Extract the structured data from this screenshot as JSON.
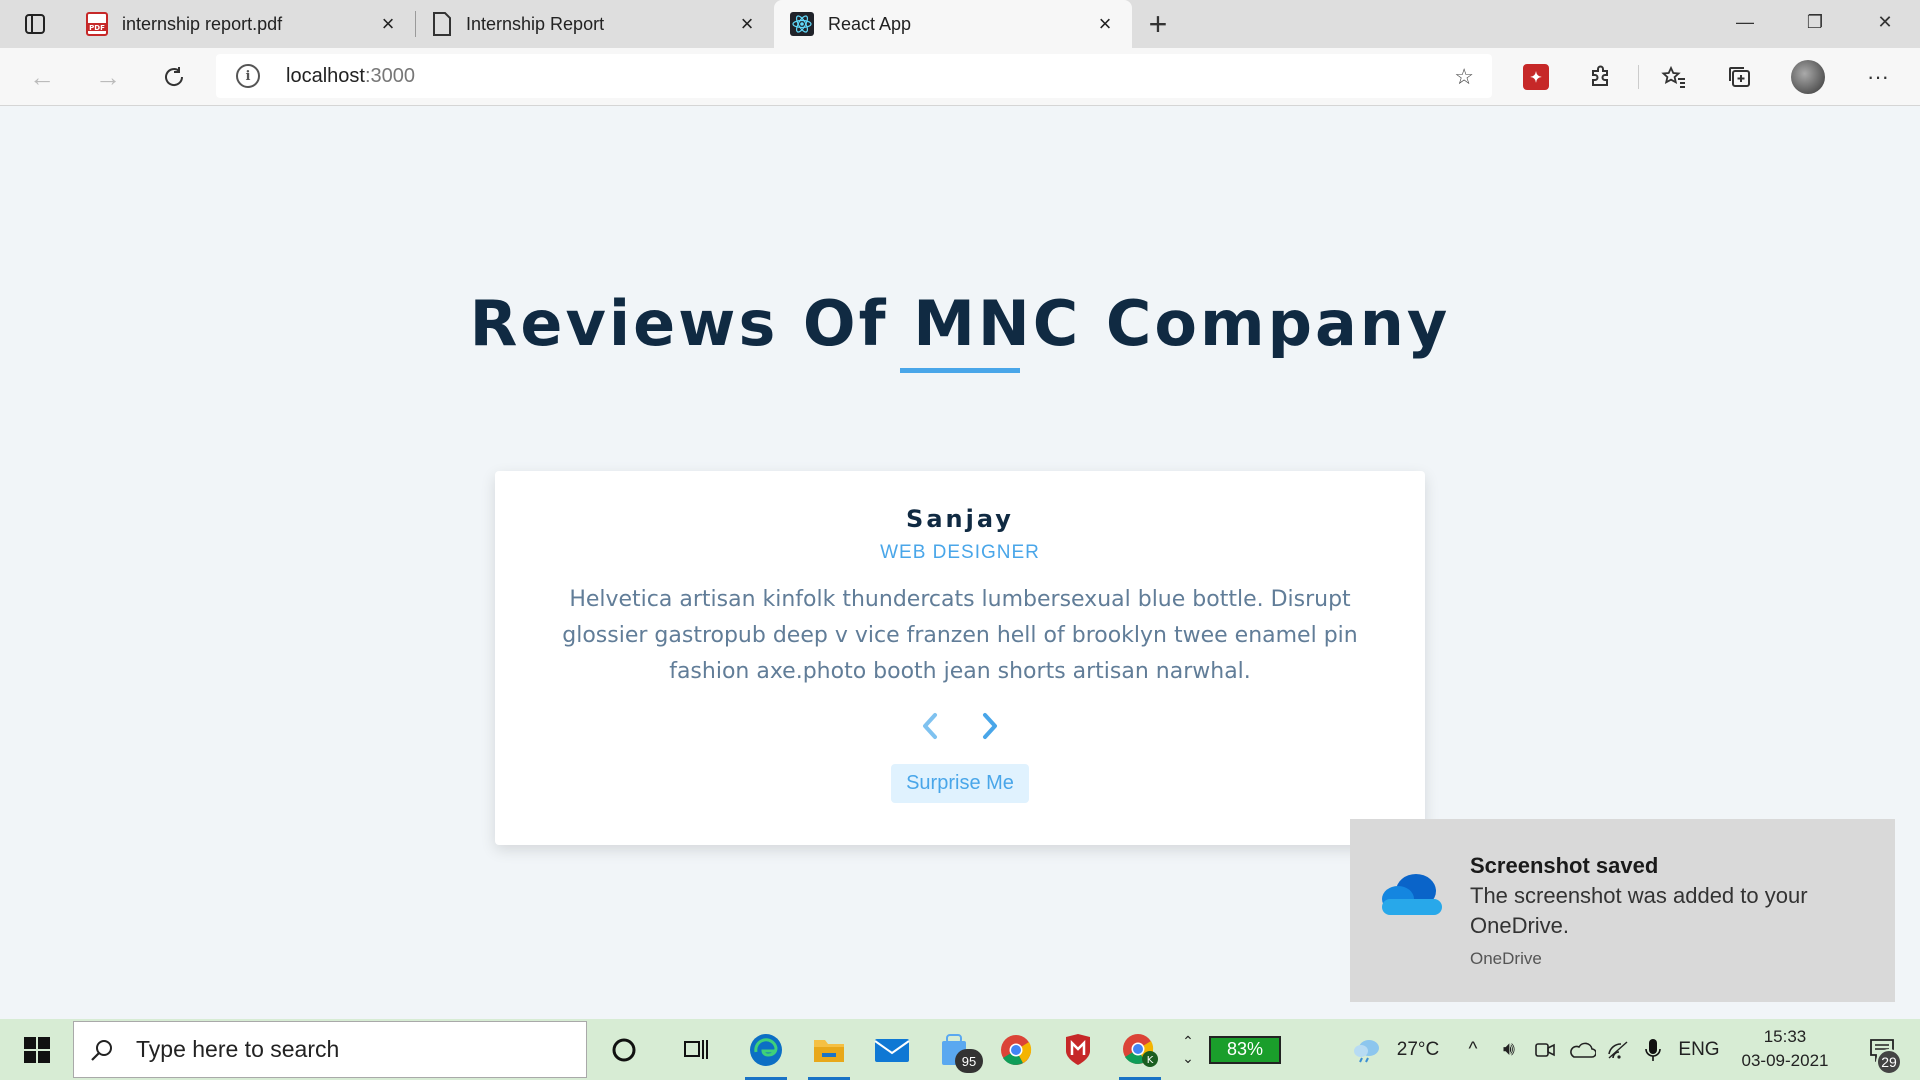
{
  "browser": {
    "tabs": [
      {
        "label": "internship report.pdf",
        "icon": "pdf-icon"
      },
      {
        "label": "Internship Report",
        "icon": "document-icon"
      },
      {
        "label": "React App",
        "icon": "react-icon"
      }
    ],
    "address": {
      "host": "localhost",
      "port": ":3000"
    }
  },
  "page": {
    "title": "Reviews Of MNC Company",
    "review": {
      "name": "Sanjay",
      "job": "web designer",
      "text": "Helvetica artisan kinfolk thundercats lumbersexual blue bottle. Disrupt glossier gastropub deep v vice franzen hell of brooklyn twee enamel pin fashion axe.photo booth jean shorts artisan narwhal."
    },
    "surprise_label": "Surprise Me",
    "accent_color": "#49a6e9",
    "heading_color": "#102a42"
  },
  "toast": {
    "title": "Screenshot saved",
    "body": "The screenshot was added to your OneDrive.",
    "source": "OneDrive"
  },
  "taskbar": {
    "search_placeholder": "Type here to search",
    "mail_badge": "95",
    "battery": "83%",
    "weather": "27°C",
    "language": "ENG",
    "time": "15:33",
    "date": "03-09-2021",
    "notifications": "29"
  }
}
